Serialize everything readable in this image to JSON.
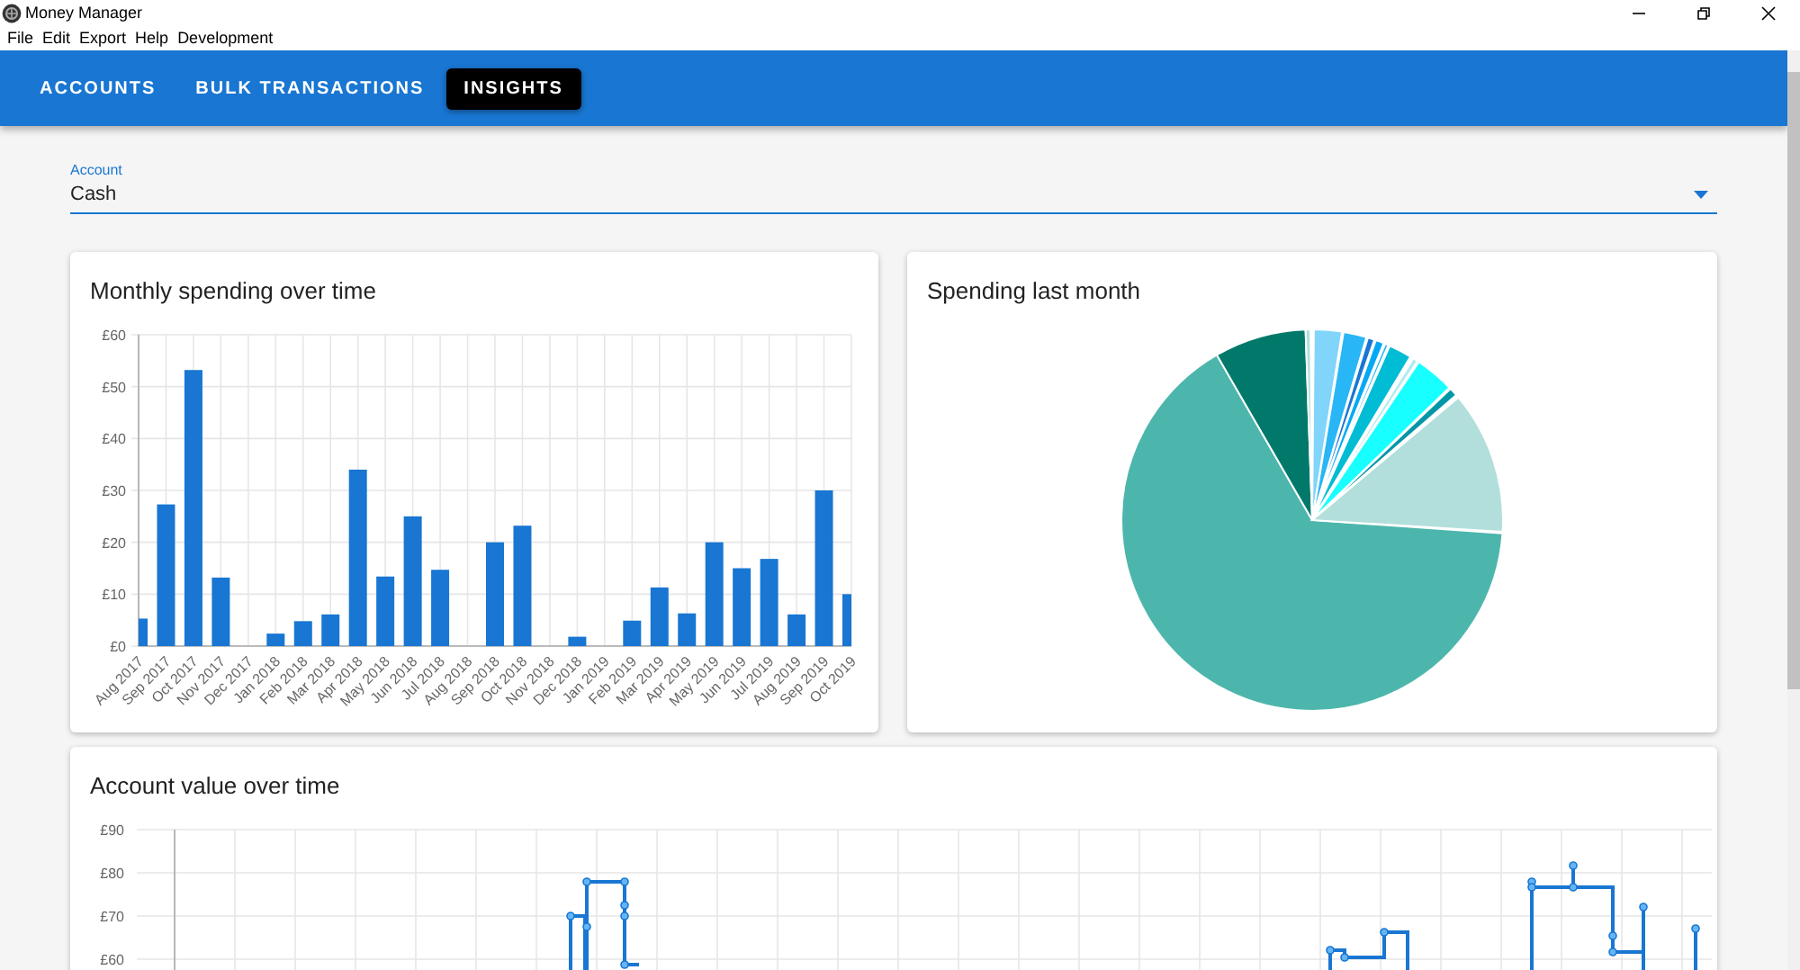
{
  "window": {
    "title": "Money Manager"
  },
  "menu": [
    "File",
    "Edit",
    "Export",
    "Help",
    "Development"
  ],
  "tabs": [
    {
      "label": "ACCOUNTS",
      "selected": false
    },
    {
      "label": "BULK TRANSACTIONS",
      "selected": false
    },
    {
      "label": "INSIGHTS",
      "selected": true
    }
  ],
  "account_select": {
    "label": "Account",
    "value": "Cash"
  },
  "monthly_spending": {
    "title": "Monthly spending over time",
    "chart_data": {
      "type": "bar",
      "categories": [
        "Aug 2017",
        "Sep 2017",
        "Oct 2017",
        "Nov 2017",
        "Dec 2017",
        "Jan 2018",
        "Feb 2018",
        "Mar 2018",
        "Apr 2018",
        "May 2018",
        "Jun 2018",
        "Jul 2018",
        "Aug 2018",
        "Sep 2018",
        "Oct 2018",
        "Nov 2018",
        "Dec 2018",
        "Jan 2019",
        "Feb 2019",
        "Mar 2019",
        "Apr 2019",
        "May 2019",
        "Jun 2019",
        "Jul 2019",
        "Aug 2019",
        "Sep 2019",
        "Oct 2019"
      ],
      "values": [
        5.3,
        27.3,
        53.2,
        13.2,
        0,
        2.4,
        4.8,
        6.1,
        34,
        13.4,
        25,
        14.7,
        0,
        20,
        23.2,
        0,
        1.8,
        0,
        4.9,
        11.3,
        6.3,
        20,
        15,
        16.8,
        6.1,
        30,
        10
      ],
      "ylim": [
        0,
        60
      ],
      "grid": true,
      "yticks": [
        {
          "value": 0,
          "label": "£0"
        },
        {
          "value": 10,
          "label": "£10"
        },
        {
          "value": 20,
          "label": "£20"
        },
        {
          "value": 30,
          "label": "£30"
        },
        {
          "value": 40,
          "label": "£40"
        },
        {
          "value": 50,
          "label": "£50"
        },
        {
          "value": 60,
          "label": "£60"
        }
      ]
    }
  },
  "spending_last_month": {
    "title": "Spending last month"
  },
  "account_value": {
    "title": "Account value over time",
    "tick_labels": [
      "£90",
      "£80",
      "£70",
      "£60"
    ]
  }
}
